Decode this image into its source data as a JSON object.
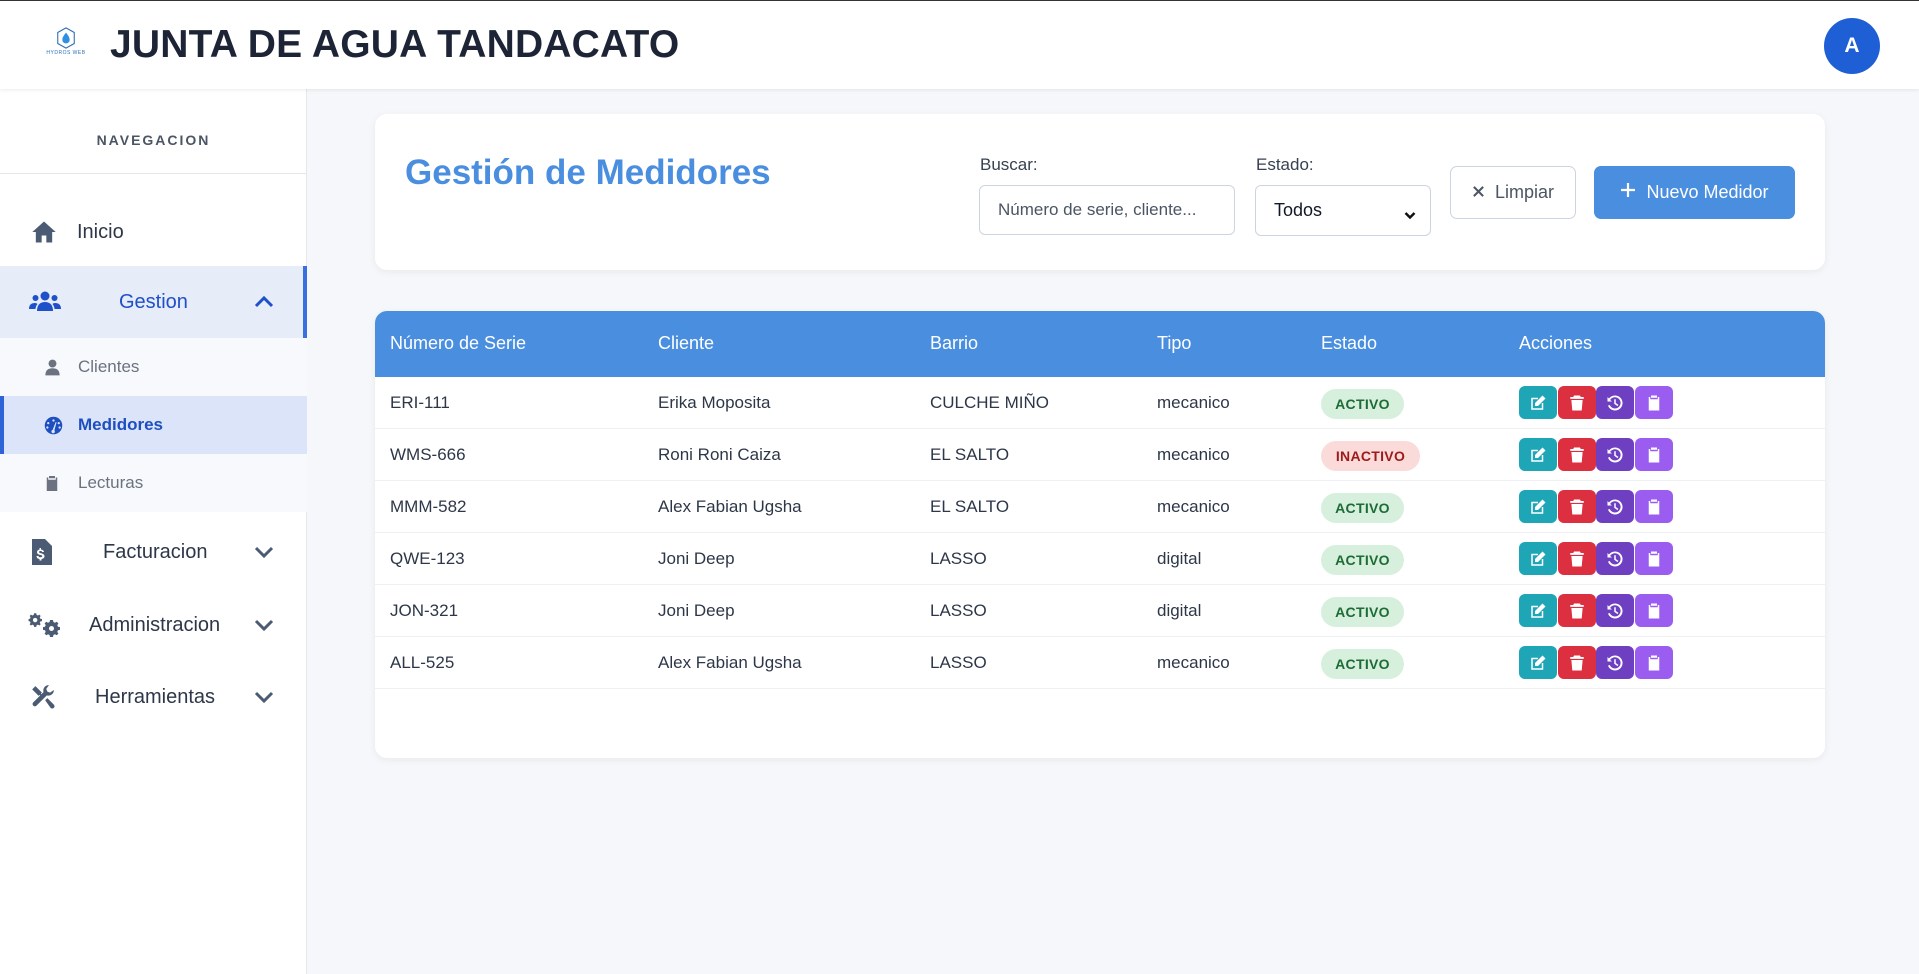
{
  "header": {
    "logo_text": "HYDROS WEB",
    "title": "JUNTA DE AGUA TANDACATO",
    "avatar_initial": "A"
  },
  "sidebar": {
    "heading": "NAVEGACION",
    "items": [
      {
        "label": "Inicio",
        "icon": "home-icon"
      },
      {
        "label": "Gestion",
        "icon": "users-icon",
        "expanded": true
      },
      {
        "label": "Facturacion",
        "icon": "invoice-icon",
        "expanded": false
      },
      {
        "label": "Administracion",
        "icon": "gears-icon",
        "expanded": false
      },
      {
        "label": "Herramientas",
        "icon": "tools-icon",
        "expanded": false
      }
    ],
    "subitems": [
      {
        "label": "Clientes",
        "icon": "user-icon"
      },
      {
        "label": "Medidores",
        "icon": "gauge-icon",
        "current": true
      },
      {
        "label": "Lecturas",
        "icon": "clipboard-icon"
      }
    ]
  },
  "toolbar": {
    "page_title": "Gestión de Medidores",
    "search_label": "Buscar:",
    "search_placeholder": "Número de serie, cliente...",
    "status_label": "Estado:",
    "status_value": "Todos",
    "clear_label": "Limpiar",
    "new_label": "Nuevo Medidor"
  },
  "table": {
    "headers": [
      "Número de Serie",
      "Cliente",
      "Barrio",
      "Tipo",
      "Estado",
      "Acciones"
    ],
    "rows": [
      {
        "serie": "ERI-111",
        "cliente": "Erika Moposita",
        "barrio": "CULCHE MIÑO",
        "tipo": "mecanico",
        "estado": "ACTIVO"
      },
      {
        "serie": "WMS-666",
        "cliente": "Roni Roni Caiza",
        "barrio": "EL SALTO",
        "tipo": "mecanico",
        "estado": "INACTIVO"
      },
      {
        "serie": "MMM-582",
        "cliente": "Alex Fabian Ugsha",
        "barrio": "EL SALTO",
        "tipo": "mecanico",
        "estado": "ACTIVO"
      },
      {
        "serie": "QWE-123",
        "cliente": "Joni Deep",
        "barrio": "LASSO",
        "tipo": "digital",
        "estado": "ACTIVO"
      },
      {
        "serie": "JON-321",
        "cliente": "Joni Deep",
        "barrio": "LASSO",
        "tipo": "digital",
        "estado": "ACTIVO"
      },
      {
        "serie": "ALL-525",
        "cliente": "Alex Fabian Ugsha",
        "barrio": "LASSO",
        "tipo": "mecanico",
        "estado": "ACTIVO"
      }
    ]
  },
  "colors": {
    "primary": "#4a8ee0",
    "edit": "#1ea5b6",
    "delete": "#dc2f3f",
    "history": "#6f3fc1",
    "clipboard": "#9b5cf0",
    "active_badge_bg": "#d7f0dd",
    "inactive_badge_bg": "#fbdada"
  }
}
